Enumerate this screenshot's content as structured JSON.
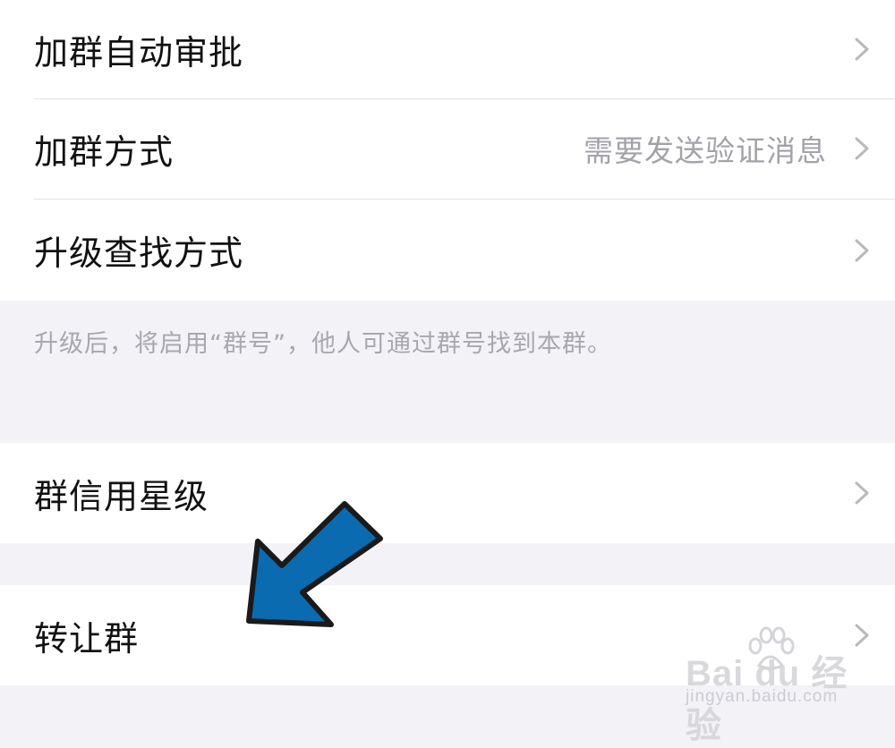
{
  "group1": {
    "rows": [
      {
        "label": "加群自动审批",
        "value": ""
      },
      {
        "label": "加群方式",
        "value": "需要发送验证消息"
      },
      {
        "label": "升级查找方式",
        "value": ""
      }
    ]
  },
  "upgrade_note": "升级后，将启用“群号”，他人可通过群号找到本群。",
  "group2": {
    "rows": [
      {
        "label": "群信用星级"
      }
    ]
  },
  "group3": {
    "rows": [
      {
        "label": "转让群"
      }
    ]
  },
  "annotation": {
    "arrow_color": "#0b6bb0",
    "points_to": "转让群"
  },
  "watermark": {
    "brand": "Bai du 经验",
    "url": "jingyan.baidu.com"
  },
  "colors": {
    "background": "#f2f2f7",
    "card": "#ffffff",
    "secondary_text": "#a2a2a8"
  }
}
